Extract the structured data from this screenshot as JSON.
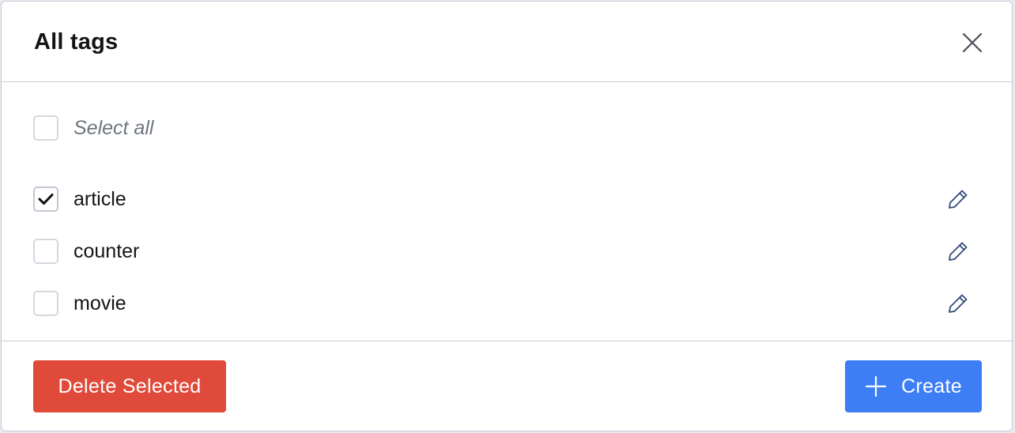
{
  "modal": {
    "title": "All tags",
    "close_icon": "close-icon"
  },
  "select_all": {
    "label": "Select all",
    "checked": false
  },
  "tags": [
    {
      "name": "article",
      "checked": true,
      "edit_icon": "pencil-icon"
    },
    {
      "name": "counter",
      "checked": false,
      "edit_icon": "pencil-icon"
    },
    {
      "name": "movie",
      "checked": false,
      "edit_icon": "pencil-icon"
    }
  ],
  "footer": {
    "delete_label": "Delete Selected",
    "create_label": "Create",
    "create_icon": "plus-icon"
  },
  "colors": {
    "danger": "#e04a3a",
    "primary": "#3d7ef5",
    "icon": "#2f4a7a"
  }
}
